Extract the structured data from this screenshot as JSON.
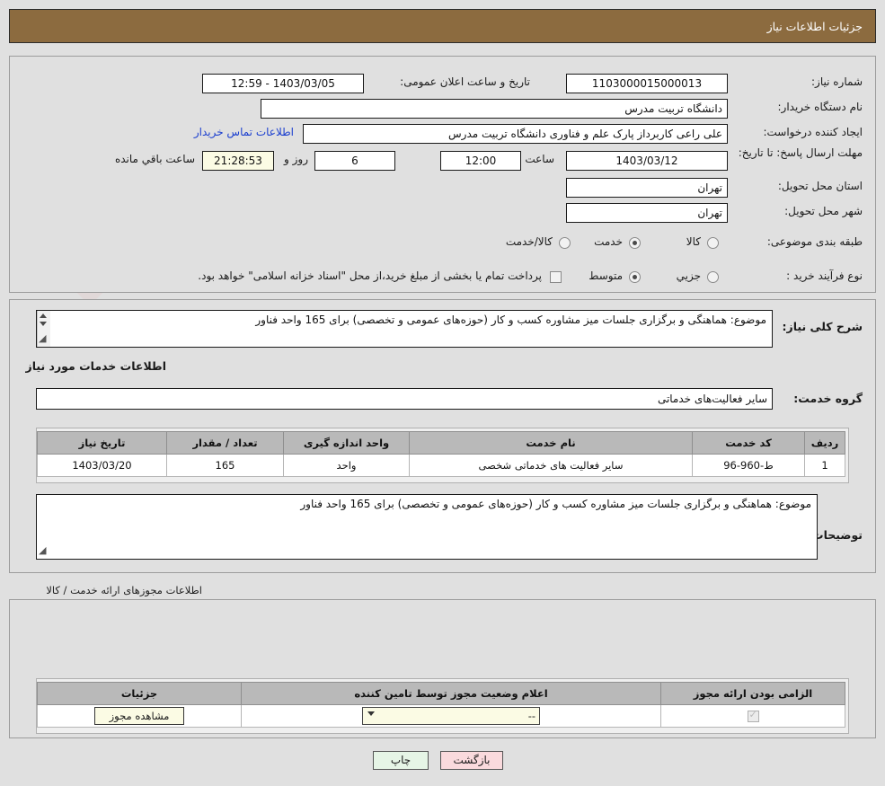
{
  "header": {
    "title": "جزئیات اطلاعات نیاز"
  },
  "top_form": {
    "need_number_label": "شماره نیاز:",
    "need_number_value": "1103000015000013",
    "public_announce_label": "تاریخ و ساعت اعلان عمومی:",
    "public_announce_value": "1403/03/05 - 12:59",
    "buyer_org_label": "نام دستگاه خریدار:",
    "buyer_org_value": "دانشگاه تربیت مدرس",
    "requester_label": "ایجاد کننده درخواست:",
    "requester_value": "علی راعی کاربرداز پارک علم و فناوری دانشگاه تربیت مدرس",
    "contact_link": "اطلاعات تماس خریدار",
    "deadline_label": "مهلت ارسال پاسخ: تا تاریخ:",
    "deadline_date": "1403/03/12",
    "hour_label": "ساعت",
    "hour_value": "12:00",
    "days_value": "6",
    "days_label": "روز و",
    "countdown_value": "21:28:53",
    "remaining_label": "ساعت باقي مانده",
    "province_label": "استان محل تحویل:",
    "province_value": "تهران",
    "city_label": "شهر محل تحویل:",
    "city_value": "تهران",
    "category_label": "طبقه بندی موضوعی:",
    "category_options": [
      {
        "label": "کالا",
        "selected": false
      },
      {
        "label": "خدمت",
        "selected": true
      },
      {
        "label": "کالا/خدمت",
        "selected": false
      }
    ],
    "process_label": "نوع فرآیند خرید :",
    "process_options": [
      {
        "label": "جزیي",
        "selected": false
      },
      {
        "label": "متوسط",
        "selected": true
      }
    ],
    "treasury_checkbox_text": "پرداخت تمام یا بخشی از مبلغ خرید،از محل \"اسناد خزانه اسلامی\" خواهد بود."
  },
  "middle": {
    "general_desc_label": "شرح کلی نیاز:",
    "general_desc_value": "موضوع: هماهنگی و برگزاری جلسات میز مشاوره کسب و کار (حوزه‌های عمومی و تخصصی) برای 165 واحد فناور",
    "services_info_title": "اطلاعات خدمات مورد نیاز",
    "service_group_label": "گروه خدمت:",
    "service_group_value": "سایر فعالیت‌های خدماتی",
    "buyer_notes_label": "توضیحات خریدار:",
    "buyer_notes_value": "موضوع: هماهنگی و برگزاری جلسات میز مشاوره کسب و کار (حوزه‌های عمومی و تخصصی) برای 165 واحد فناور"
  },
  "services_table": {
    "headers": [
      "ردیف",
      "کد خدمت",
      "نام خدمت",
      "واحد اندازه گیری",
      "تعداد / مقدار",
      "تاریخ نیاز"
    ],
    "rows": [
      [
        "1",
        "ط-960-96",
        "سایر فعالیت های خدماتی شخصی",
        "واحد",
        "165",
        "1403/03/20"
      ]
    ]
  },
  "licenses": {
    "section_title": "اطلاعات مجوزهای ارائه خدمت / کالا",
    "headers": [
      "الزامی بودن ارائه مجوز",
      "اعلام وضعیت مجوز توسط تامین کننده",
      "جزئیات"
    ],
    "rows": [
      {
        "required_checked": true,
        "status_value": "--",
        "details_button": "مشاهده مجوز"
      }
    ]
  },
  "footer": {
    "print_label": "چاپ",
    "back_label": "بازگشت"
  },
  "watermark": {
    "text": "AriaTender.net"
  },
  "colors": {
    "header_bar": "#8c6b3f",
    "page_bg": "#e0e0e0",
    "link": "#1b3fcf",
    "table_header": "#b9b9b9",
    "print_btn": "#e6f5e6",
    "back_btn": "#fadadd",
    "highlight_field": "#fbfbe4"
  }
}
